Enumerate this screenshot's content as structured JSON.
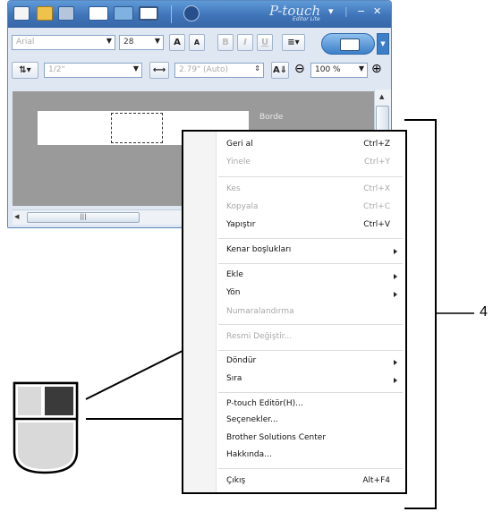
{
  "app": {
    "brand": "P-touch",
    "brand_sub": "Editor Lite",
    "window_controls": [
      "▾",
      "|",
      "−",
      "✕"
    ]
  },
  "toolbar": {
    "font_name": "Arial",
    "font_size": "28",
    "grow_font_label": "A",
    "shrink_font_label": "A",
    "bold_label": "B",
    "italic_label": "I",
    "underline_label": "U",
    "tape_size": "1/2\"",
    "length": "2.79\" (Auto)",
    "zoom": "100 %",
    "zoom_out": "⊖",
    "zoom_in": "⊕"
  },
  "canvas": {
    "side_label": "Borde"
  },
  "context_menu": {
    "items": [
      {
        "label": "Geri al",
        "shortcut": "Ctrl+Z",
        "enabled": true
      },
      {
        "label": "Yinele",
        "shortcut": "Ctrl+Y",
        "enabled": false
      },
      {
        "label": "Kes",
        "shortcut": "Ctrl+X",
        "enabled": false
      },
      {
        "label": "Kopyala",
        "shortcut": "Ctrl+C",
        "enabled": false
      },
      {
        "label": "Yapıştır",
        "shortcut": "Ctrl+V",
        "enabled": true
      },
      {
        "label": "Kenar boşlukları",
        "shortcut": "",
        "enabled": true,
        "submenu": true
      },
      {
        "label": "Ekle",
        "shortcut": "",
        "enabled": true,
        "submenu": true
      },
      {
        "label": "Yön",
        "shortcut": "",
        "enabled": true,
        "submenu": true
      },
      {
        "label": "Numaralandırma",
        "shortcut": "",
        "enabled": false
      },
      {
        "label": "Resmi Değiştir...",
        "shortcut": "",
        "enabled": false
      },
      {
        "label": "Döndür",
        "shortcut": "",
        "enabled": true,
        "submenu": true
      },
      {
        "label": "Sıra",
        "shortcut": "",
        "enabled": true,
        "submenu": true
      },
      {
        "label": "P-touch Editör(H)...",
        "shortcut": "",
        "enabled": true
      },
      {
        "label": "Seçenekler...",
        "shortcut": "",
        "enabled": true
      },
      {
        "label": "Brother Solutions Center",
        "shortcut": "",
        "enabled": true
      },
      {
        "label": "Hakkında...",
        "shortcut": "",
        "enabled": true
      },
      {
        "label": "Çıkış",
        "shortcut": "Alt+F4",
        "enabled": true
      }
    ]
  },
  "callout": {
    "number": "4"
  }
}
